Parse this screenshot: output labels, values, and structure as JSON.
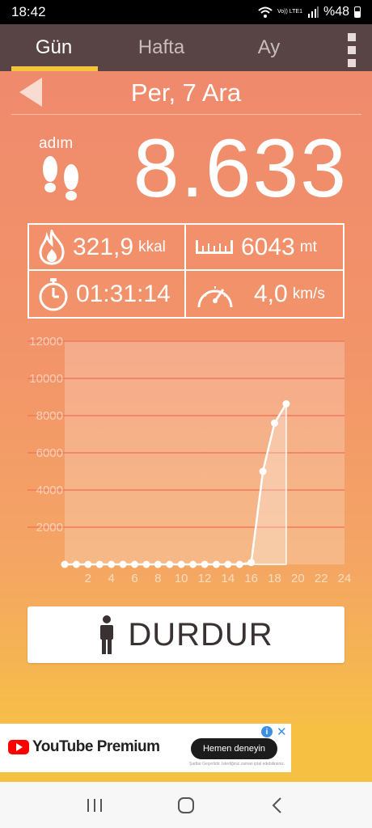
{
  "status": {
    "time": "18:42",
    "network": "Vo)) LTE1",
    "battery": "%48"
  },
  "tabs": [
    {
      "label": "Gün",
      "active": true
    },
    {
      "label": "Hafta",
      "active": false
    },
    {
      "label": "Ay",
      "active": false
    }
  ],
  "date": {
    "label": "Per, 7 Ara"
  },
  "steps": {
    "label": "adım",
    "value": "8.633"
  },
  "stats": {
    "calories": {
      "value": "321,9",
      "unit": "kkal"
    },
    "distance": {
      "value": "6043",
      "unit": "mt"
    },
    "duration": {
      "value": "01:31:14"
    },
    "speed": {
      "value": "4,0",
      "unit": "km/s"
    }
  },
  "chart_data": {
    "type": "area",
    "x": [
      0,
      1,
      2,
      3,
      4,
      5,
      6,
      7,
      8,
      9,
      10,
      11,
      12,
      13,
      14,
      15,
      16,
      17,
      18,
      19
    ],
    "values": [
      0,
      0,
      0,
      0,
      0,
      0,
      0,
      0,
      0,
      0,
      0,
      0,
      0,
      0,
      0,
      0,
      100,
      5000,
      7600,
      8633
    ],
    "x_ticks": [
      "2",
      "4",
      "6",
      "8",
      "10",
      "12",
      "14",
      "16",
      "18",
      "20",
      "22",
      "24"
    ],
    "y_ticks": [
      "2000",
      "4000",
      "6000",
      "8000",
      "10000",
      "12000"
    ],
    "xlim": [
      0,
      24
    ],
    "ylim": [
      0,
      12000
    ],
    "grid": true
  },
  "button": {
    "label": "DURDUR"
  },
  "ad": {
    "brand": "YouTube Premium",
    "cta": "Hemen deneyin",
    "fine_print": "Şartlar Geçerlidir. İstediğiniz zaman iptal edebilirsiniz.",
    "info": "i",
    "close": "✕"
  }
}
